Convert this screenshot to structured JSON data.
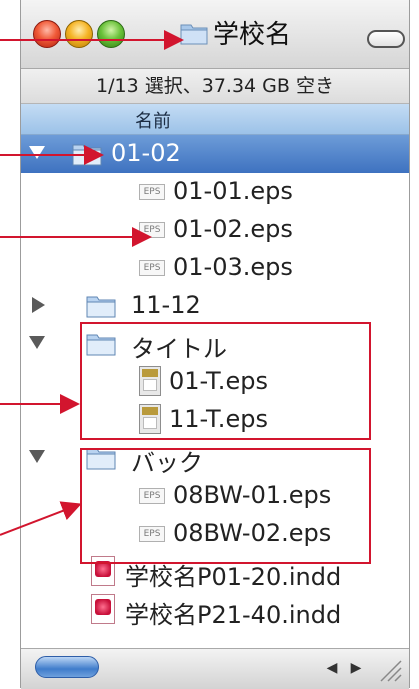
{
  "window": {
    "title": "学校名",
    "status_text": "1/13 選択、37.34 GB 空き",
    "column_header": "名前"
  },
  "rows": [
    {
      "label": "01-02",
      "kind": "folder",
      "expanded": true,
      "selected": true
    },
    {
      "label": "01-01.eps",
      "kind": "eps"
    },
    {
      "label": "01-02.eps",
      "kind": "eps"
    },
    {
      "label": "01-03.eps",
      "kind": "eps"
    },
    {
      "label": "11-12",
      "kind": "folder",
      "expanded": false
    },
    {
      "label": "タイトル",
      "kind": "folder",
      "expanded": true
    },
    {
      "label": "01-T.eps",
      "kind": "eps-thumb"
    },
    {
      "label": "11-T.eps",
      "kind": "eps-thumb"
    },
    {
      "label": "バック",
      "kind": "folder",
      "expanded": true
    },
    {
      "label": "08BW-01.eps",
      "kind": "eps"
    },
    {
      "label": "08BW-02.eps",
      "kind": "eps"
    },
    {
      "label": "学校名P01-20.indd",
      "kind": "indd"
    },
    {
      "label": "学校名P21-40.indd",
      "kind": "indd"
    }
  ],
  "colors": {
    "annotation": "#d2152e",
    "selection": "#3e72c0",
    "header": "#9cc2e8"
  },
  "icons": {
    "close": "close-icon",
    "minimize": "minimize-icon",
    "zoom": "zoom-icon",
    "folder": "folder-icon",
    "eps": "eps-file-icon",
    "indd": "indd-file-icon"
  }
}
